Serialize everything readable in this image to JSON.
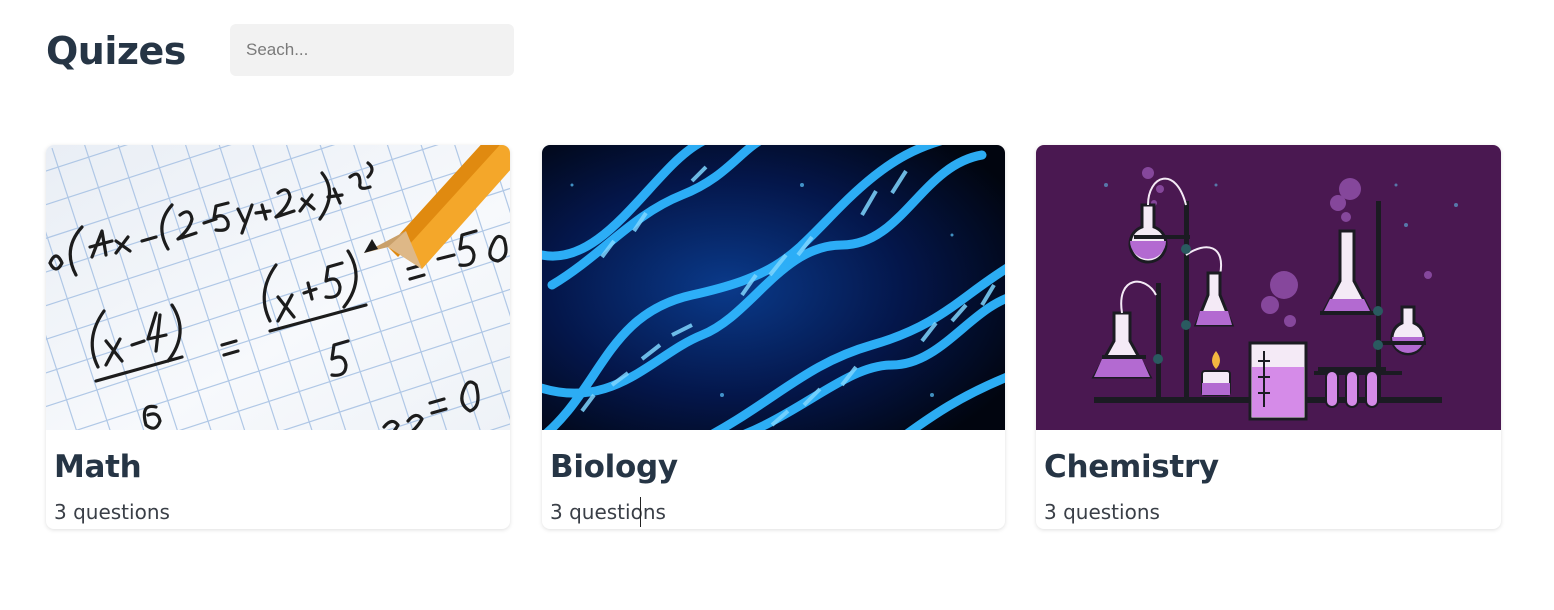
{
  "header": {
    "title": "Quizes",
    "search_placeholder": "Seach..."
  },
  "quizzes": [
    {
      "title": "Math",
      "count": "3 questions",
      "image": "math-worksheet-with-pencil"
    },
    {
      "title": "Biology",
      "count": "3 questions",
      "image": "dna-double-helix"
    },
    {
      "title": "Chemistry",
      "count": "3 questions",
      "image": "chemistry-lab-glassware"
    }
  ],
  "colors": {
    "heading": "#263545",
    "search_bg": "#f2f2f2",
    "chemistry_bg": "#4a1851",
    "dna_blue": "#29a9f0"
  }
}
